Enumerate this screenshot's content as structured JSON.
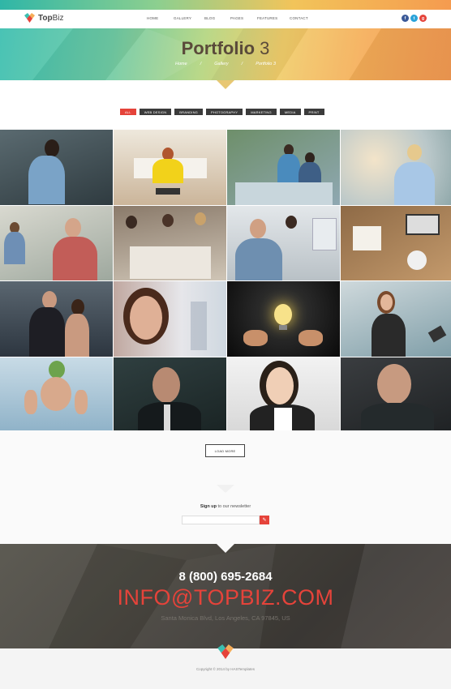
{
  "brand": {
    "name_top": "Top",
    "name_biz": "Biz"
  },
  "nav": {
    "items": [
      "HOME",
      "GALLERY",
      "BLOG",
      "PAGES",
      "FEATURES",
      "CONTACT"
    ]
  },
  "social": [
    {
      "icon": "facebook-icon",
      "glyph": "f",
      "color": "#3b5998"
    },
    {
      "icon": "twitter-icon",
      "glyph": "t",
      "color": "#2aa3d9"
    },
    {
      "icon": "google-plus-icon",
      "glyph": "g",
      "color": "#e5433a"
    }
  ],
  "hero": {
    "title_bold": "Portfolio",
    "title_num": "3",
    "breadcrumb": [
      "Home",
      "Gallery",
      "Portfolio 3"
    ],
    "separator": "/"
  },
  "filters": [
    "ALL",
    "WEB DESIGN",
    "BRANDING",
    "PHOTOGRAPHY",
    "MARKETING",
    "MEDIA",
    "PRINT"
  ],
  "load_more": "LOAD MORE",
  "newsletter": {
    "bold": "Sign up",
    "rest": " to our newsletter",
    "button_glyph": "✎"
  },
  "contact": {
    "phone": "8 (800) 695-2684",
    "email": "INFO@TOPBIZ.COM",
    "address": "Santa Monica Blvd, Los Angeles, CA 97845, US"
  },
  "copyright": "Copyright © 2014 by HASTemplates",
  "colors": {
    "accent": "#e5433a",
    "dark": "#3b3b3b"
  }
}
